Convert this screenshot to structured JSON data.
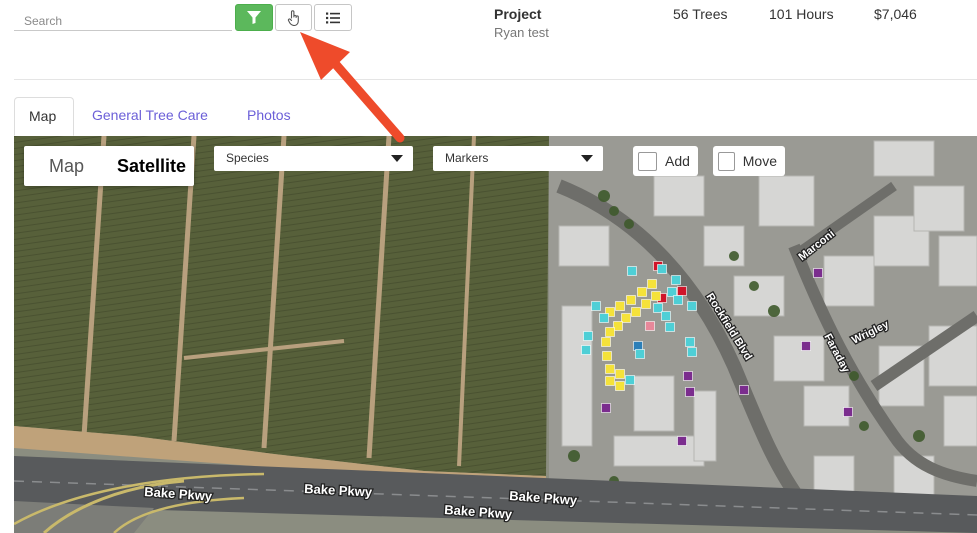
{
  "search": {
    "placeholder": "Search",
    "value": ""
  },
  "toolbar": {
    "filter_icon": "filter-icon",
    "tap_icon": "hand-pointer-icon",
    "list_icon": "list-icon",
    "filter_color": "#5cb85c"
  },
  "project": {
    "label": "Project",
    "name": "Ryan test"
  },
  "stats": {
    "trees": "56 Trees",
    "hours": "101 Hours",
    "cost": "$7,046"
  },
  "tabs": [
    {
      "label": "Map",
      "active": true
    },
    {
      "label": "General Tree Care",
      "active": false
    },
    {
      "label": "Photos",
      "active": false
    }
  ],
  "map": {
    "type_options": [
      "Map",
      "Satellite"
    ],
    "selected_type": "Satellite",
    "species_select": "Species",
    "markers_select": "Markers",
    "add_label": "Add",
    "move_label": "Move",
    "roads": [
      "Bake Pkwy",
      "Bake Pkwy",
      "Bake Pkwy",
      "Bake Pkwy",
      "Rockfield Blvd",
      "Marconi",
      "Wrigley",
      "Faraday"
    ]
  },
  "colors": {
    "accent": "#6b5fd8",
    "annotation_arrow": "#ee4b2b",
    "marker_yellow": "#f5e23a",
    "marker_cyan": "#4ecfd6",
    "marker_purple": "#7b2d8e",
    "marker_red": "#d0152a",
    "marker_pink": "#e8889a",
    "marker_blue": "#2c7fb8"
  }
}
